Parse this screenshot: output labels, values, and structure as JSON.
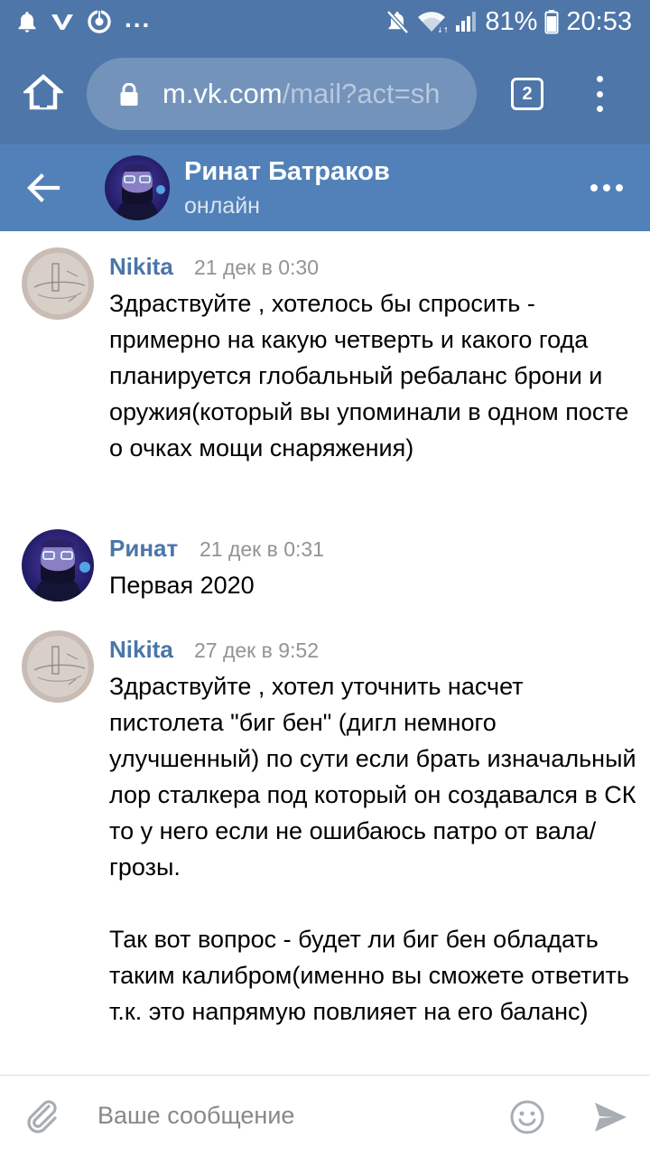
{
  "status_bar": {
    "notifications": [
      "bell-icon",
      "vk-icon",
      "vk-clips-icon"
    ],
    "more": "...",
    "battery": "81%",
    "time": "20:53"
  },
  "browser": {
    "url_host": "m.vk.com",
    "url_path": "/mail?act=sh",
    "tab_count": "2"
  },
  "chat": {
    "name": "Ринат Батраков",
    "status": "онлайн"
  },
  "messages": [
    {
      "author": "Nikita",
      "time": "21 дек в 0:30",
      "text": "Здраствуйте , хотелось бы спросить - примерно на какую четверть и какого года планируется глобальный ребаланс брони и оружия(который вы упоминали в одном посте о очках мощи снаряжения)"
    },
    {
      "author": "Ринат",
      "time": "21 дек в 0:31",
      "text": "Первая 2020"
    },
    {
      "author": "Nikita",
      "time": "27 дек в 9:52",
      "text": "Здраствуйте , хотел уточнить насчет пистолета \"биг бен\" (дигл немного улучшенный) по сути если брать изначальный лор сталкера под который он создавался в СК то у него если не ошибаюсь патро от вала/грозы.\n\nТак вот вопрос - будет ли биг бен обладать таким калибром(именно вы сможете ответить т.к. это напрямую повлияет на его баланс)"
    }
  ],
  "composer": {
    "placeholder": "Ваше сообщение"
  },
  "colors": {
    "status_bar": "#4e76a8",
    "chat_header": "#5181b8",
    "author": "#4a76a8",
    "time": "#939393"
  }
}
